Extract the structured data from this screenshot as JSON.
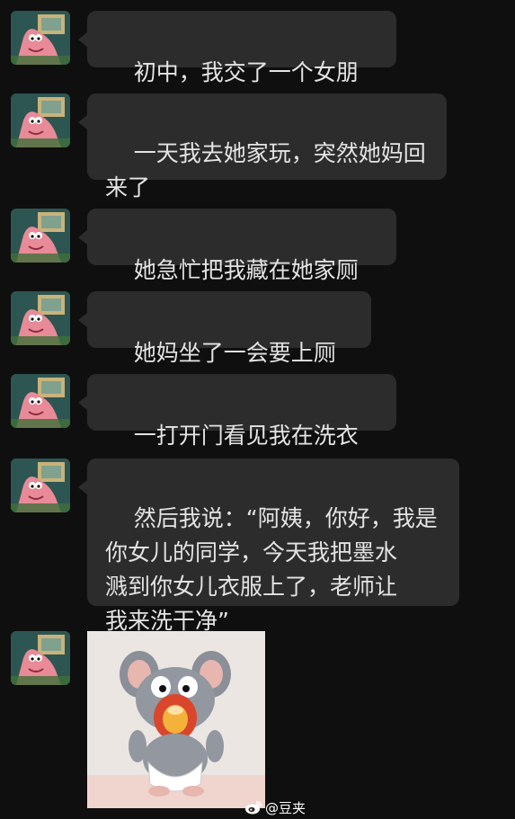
{
  "messages": [
    {
      "text": "初中，我交了一个女朋友"
    },
    {
      "text": "一天我去她家玩，突然她妈回\n来了"
    },
    {
      "text": "她急忙把我藏在她家厕所"
    },
    {
      "text": "她妈坐了一会要上厕所"
    },
    {
      "text": "一打开门看见我在洗衣服"
    },
    {
      "text": "然后我说：“阿姨，你好，我是\n你女儿的同学，今天我把墨水\n溅到你女儿衣服上了，老师让\n我来洗干净”"
    }
  ],
  "sticker": {
    "icon": "shocked-mouse-sticker-icon"
  },
  "watermark": {
    "text": "@豆夹",
    "icon": "weibo-logo-icon"
  },
  "avatar": {
    "icon": "patrick-star-avatar-icon"
  },
  "colors": {
    "background": "#0f0f0f",
    "bubble": "#2c2c2c",
    "text": "#e4e4e4"
  }
}
